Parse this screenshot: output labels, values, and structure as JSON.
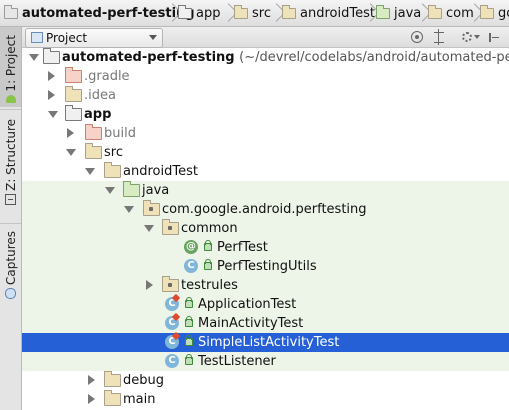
{
  "breadcrumbs": [
    {
      "label": "automated-perf-testing",
      "icon": "project-folder-icon"
    },
    {
      "label": "app",
      "icon": "module-folder-icon"
    },
    {
      "label": "src",
      "icon": "folder-icon"
    },
    {
      "label": "androidTest",
      "icon": "folder-icon"
    },
    {
      "label": "java",
      "icon": "test-source-folder-icon"
    },
    {
      "label": "com",
      "icon": "package-icon"
    },
    {
      "label": "go",
      "icon": "package-icon"
    }
  ],
  "tool_strip": {
    "project_tab": "1: Project",
    "structure_tab": "Z: Structure",
    "captures_tab": "Captures"
  },
  "panel_header": {
    "view_selector": "Project"
  },
  "tree": [
    {
      "label": "automated-perf-testing",
      "path": "(~/devrel/codelabs/android/automated-perf-testing)",
      "bold": true,
      "icon": "project-folder-icon",
      "expanded": true
    },
    {
      "label": ".gradle",
      "icon": "excluded-folder-icon",
      "expanded": false,
      "dim": true
    },
    {
      "label": ".idea",
      "icon": "folder-icon",
      "expanded": false,
      "dim": true
    },
    {
      "label": "app",
      "icon": "module-folder-icon",
      "expanded": true,
      "bold": true
    },
    {
      "label": "build",
      "icon": "excluded-folder-icon",
      "expanded": false,
      "dim": true
    },
    {
      "label": "src",
      "icon": "folder-icon",
      "expanded": true
    },
    {
      "label": "androidTest",
      "icon": "folder-icon",
      "expanded": true
    },
    {
      "label": "java",
      "icon": "test-source-folder-icon",
      "expanded": true
    },
    {
      "label": "com.google.android.perftesting",
      "icon": "package-icon",
      "expanded": true
    },
    {
      "label": "common",
      "icon": "package-icon",
      "expanded": true
    },
    {
      "label": "PerfTest",
      "icon": "annotation-icon"
    },
    {
      "label": "PerfTestingUtils",
      "icon": "class-icon"
    },
    {
      "label": "testrules",
      "icon": "package-icon",
      "expanded": false
    },
    {
      "label": "ApplicationTest",
      "icon": "test-class-icon"
    },
    {
      "label": "MainActivityTest",
      "icon": "test-class-icon"
    },
    {
      "label": "SimpleListActivityTest",
      "icon": "test-class-icon",
      "selected": true
    },
    {
      "label": "TestListener",
      "icon": "class-icon"
    },
    {
      "label": "debug",
      "icon": "folder-icon",
      "expanded": false
    },
    {
      "label": "main",
      "icon": "folder-icon",
      "expanded": false
    }
  ],
  "colors": {
    "selection": "#2660d6",
    "test_background": "#edf4e8"
  }
}
